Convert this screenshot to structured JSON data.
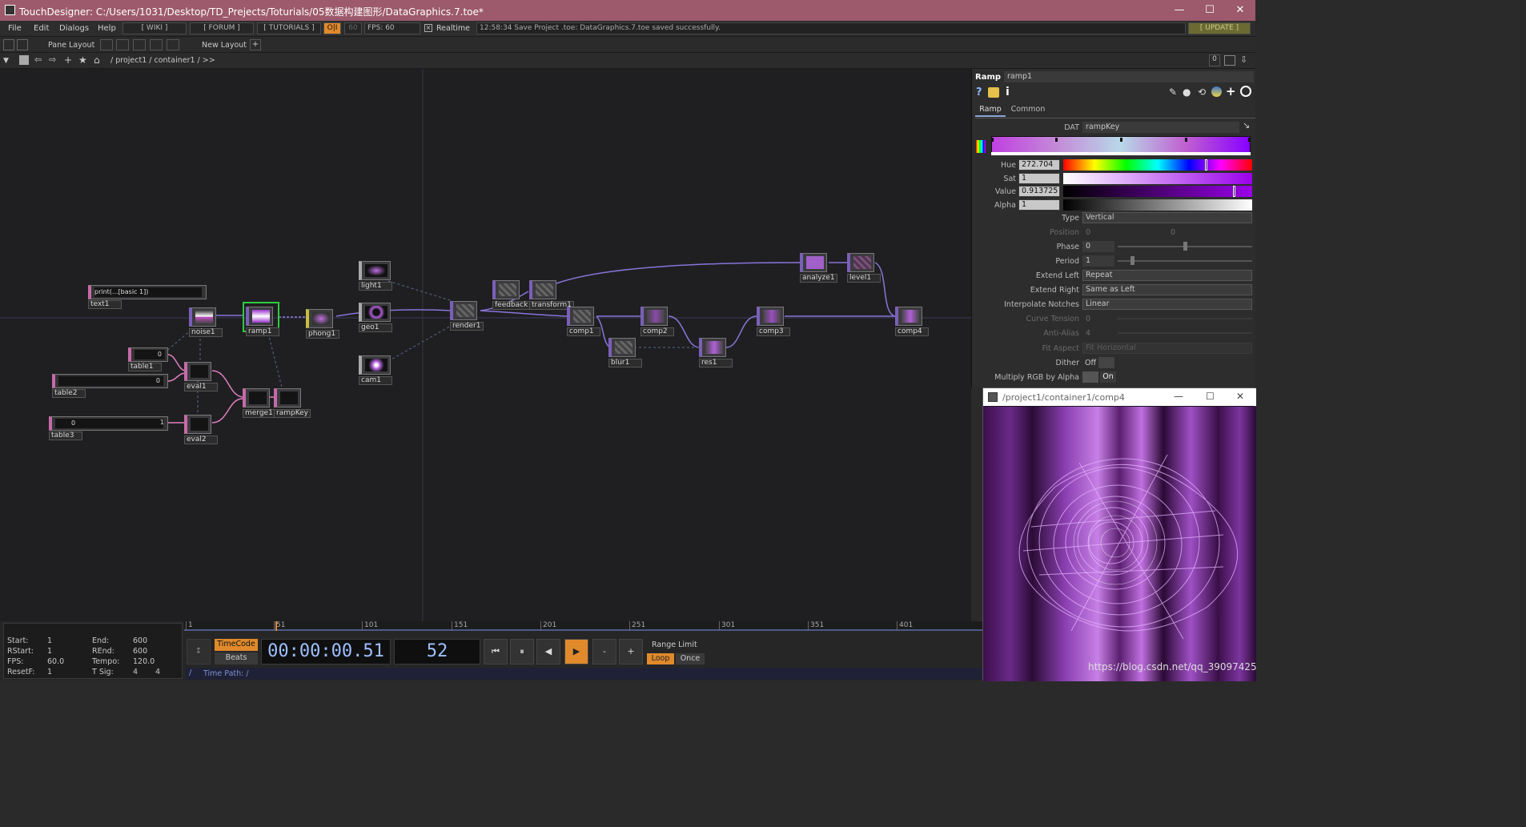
{
  "window": {
    "title": "TouchDesigner: C:/Users/1031/Desktop/TD_Prejects/Toturials/05数据构建图形/DataGraphics.7.toe*",
    "controls": [
      "—",
      "☐",
      "✕"
    ]
  },
  "menubar": {
    "items": [
      "File",
      "Edit",
      "Dialogs",
      "Help"
    ],
    "wiki": "[ WIKI ]",
    "forum": "[ FORUM ]",
    "tutorials": "[ TUTORIALS ]",
    "oi": "O|I",
    "fps_cap": "60",
    "fps": "FPS:  60",
    "realtime": "Realtime",
    "status_message": "12:58:34 Save Project .toe: DataGraphics.7.toe saved successfully.",
    "update": "[ UPDATE ]"
  },
  "panebar": {
    "pane_layout": "Pane Layout",
    "new_layout": "New Layout"
  },
  "pathbar": {
    "path": "/ project1 / container1 / >>",
    "zero": "0"
  },
  "network": {
    "nodes": [
      {
        "id": "text1",
        "label": "text1"
      },
      {
        "id": "noise1",
        "label": "noise1"
      },
      {
        "id": "ramp1",
        "label": "ramp1"
      },
      {
        "id": "phong1",
        "label": "phong1"
      },
      {
        "id": "light1",
        "label": "light1"
      },
      {
        "id": "geo1",
        "label": "geo1"
      },
      {
        "id": "cam1",
        "label": "cam1"
      },
      {
        "id": "render1",
        "label": "render1"
      },
      {
        "id": "feedback1",
        "label": "feedback"
      },
      {
        "id": "transform1",
        "label": "transform1"
      },
      {
        "id": "comp1",
        "label": "comp1"
      },
      {
        "id": "comp2",
        "label": "comp2"
      },
      {
        "id": "comp3",
        "label": "comp3"
      },
      {
        "id": "comp4",
        "label": "comp4"
      },
      {
        "id": "blur1",
        "label": "blur1"
      },
      {
        "id": "res1",
        "label": "res1"
      },
      {
        "id": "analyze1",
        "label": "analyze1"
      },
      {
        "id": "level1",
        "label": "level1"
      },
      {
        "id": "table1",
        "label": "table1"
      },
      {
        "id": "table2",
        "label": "table2"
      },
      {
        "id": "table3",
        "label": "table3"
      },
      {
        "id": "eval1",
        "label": "eval1"
      },
      {
        "id": "eval2",
        "label": "eval2"
      },
      {
        "id": "merge1",
        "label": "merge1"
      },
      {
        "id": "rampKey",
        "label": "rampKey"
      }
    ],
    "text1_content": "print(...[basic 1])",
    "table1_val": "0",
    "table2_val": "0",
    "table3_val": "0",
    "table3_val2": "1"
  },
  "params": {
    "op_type": "Ramp",
    "op_name": "ramp1",
    "tabs": [
      "Ramp",
      "Common"
    ],
    "dat_label": "DAT",
    "dat_value": "rampKey",
    "hue_label": "Hue",
    "hue": "272.704",
    "sat_label": "Sat",
    "sat": "1",
    "value_label": "Value",
    "value": "0.913725",
    "alpha_label": "Alpha",
    "alpha": "1",
    "type_label": "Type",
    "type": "Vertical",
    "position_label": "Position",
    "position_x": "0",
    "position_y": "0",
    "phase_label": "Phase",
    "phase": "0",
    "period_label": "Period",
    "period": "1",
    "extend_left_label": "Extend Left",
    "extend_left": "Repeat",
    "extend_right_label": "Extend Right",
    "extend_right": "Same as Left",
    "interp_label": "Interpolate Notches",
    "interp": "Linear",
    "curve_label": "Curve Tension",
    "curve": "0",
    "antialias_label": "Anti-Alias",
    "antialias": "4",
    "fit_label": "Fit Aspect",
    "fit": "Fit Horizontal",
    "dither_label": "Dither",
    "dither": "Off",
    "mult_label": "Multiply RGB by Alpha",
    "mult": "On"
  },
  "viewer": {
    "title": "/project1/container1/comp4",
    "controls": [
      "—",
      "☐",
      "✕"
    ]
  },
  "timeline": {
    "start_label": "Start:",
    "start": "1",
    "end_label": "End:",
    "end": "600",
    "rstart_label": "RStart:",
    "rstart": "1",
    "rend_label": "REnd:",
    "rend": "600",
    "fps_label": "FPS:",
    "fps": "60.0",
    "tempo_label": "Tempo:",
    "tempo": "120.0",
    "resetf_label": "ResetF:",
    "resetf": "1",
    "tsig_label": "T Sig:",
    "tsig_a": "4",
    "tsig_b": "4",
    "ticks": [
      "1",
      "51",
      "101",
      "151",
      "201",
      "251",
      "301",
      "351",
      "401"
    ],
    "timecode_label": "TimeCode",
    "beats_label": "Beats",
    "timecode": "00:00:00.51",
    "frame": "52",
    "range_limit": "Range Limit",
    "loop": "Loop",
    "once": "Once",
    "time_path": "Time Path: /"
  },
  "watermark": "https://blog.csdn.net/qq_39097425",
  "colors": {
    "titlebar": "#9c5a6c",
    "accent_orange": "#e08a2c",
    "selection_green": "#2ecc40",
    "wire_purple": "#8a74d8",
    "wire_pink": "#e080c0"
  }
}
